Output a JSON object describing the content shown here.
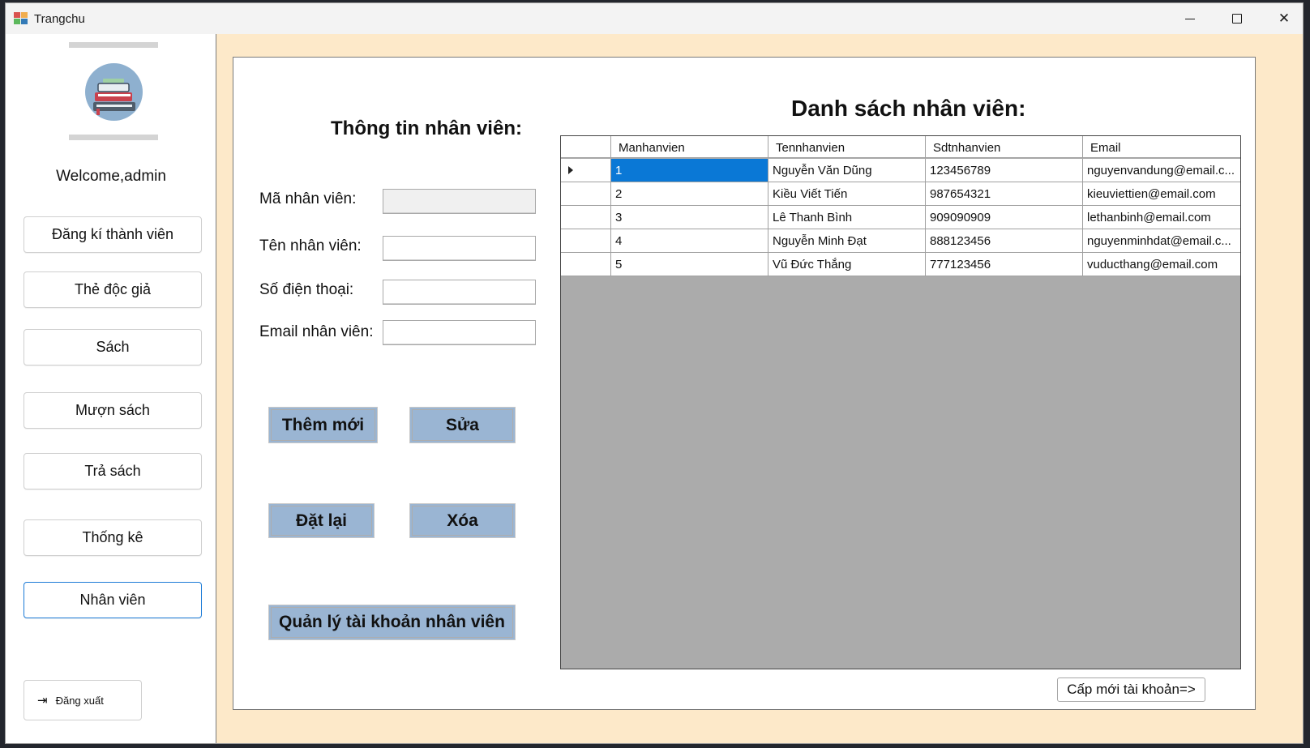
{
  "window": {
    "title": "Trangchu"
  },
  "sidebar": {
    "welcome": "Welcome,admin",
    "items": [
      {
        "label": "Đăng kí thành viên",
        "active": false
      },
      {
        "label": "Thẻ độc giả",
        "active": false
      },
      {
        "label": "Sách",
        "active": false
      },
      {
        "label": "Mượn sách",
        "active": false
      },
      {
        "label": "Trả sách",
        "active": false
      },
      {
        "label": "Thống kê",
        "active": false
      },
      {
        "label": "Nhân viên",
        "active": true
      }
    ],
    "logout_label": "Đăng xuất"
  },
  "form": {
    "title": "Thông tin nhân viên:",
    "fields": [
      {
        "label": "Mã nhân viên:",
        "value": "",
        "readonly": true
      },
      {
        "label": "Tên nhân viên:",
        "value": ""
      },
      {
        "label": "Số điện thoại:",
        "value": ""
      },
      {
        "label": "Email nhân viên:",
        "value": ""
      }
    ],
    "buttons": {
      "add": "Thêm mới",
      "edit": "Sửa",
      "reset": "Đặt lại",
      "delete": "Xóa",
      "manage_accounts": "Quản lý tài khoản nhân viên"
    }
  },
  "employee_list": {
    "title": "Danh sách nhân viên:",
    "columns": [
      "Manhanvien",
      "Tennhanvien",
      "Sdtnhanvien",
      "Email"
    ],
    "rows": [
      [
        "1",
        "Nguyễn Văn Dũng",
        "123456789",
        "nguyenvandung@email.c..."
      ],
      [
        "2",
        "Kiều Viết Tiến",
        "987654321",
        "kieuviettien@email.com"
      ],
      [
        "3",
        "Lê Thanh Bình",
        "909090909",
        "lethanbinh@email.com"
      ],
      [
        "4",
        "Nguyễn Minh Đạt",
        "888123456",
        "nguyenminhdat@email.c..."
      ],
      [
        "5",
        "Vũ Đức Thắng",
        "777123456",
        "vuducthang@email.com"
      ]
    ],
    "selected_row": 0
  },
  "grant_account_button": "Cấp mới tài khoản=>",
  "colors": {
    "background": "#fde9c9",
    "action_button": "#9ab5d3",
    "selection": "#0a78d6",
    "active_border": "#1c7bd7",
    "grid_empty": "#ababab"
  }
}
